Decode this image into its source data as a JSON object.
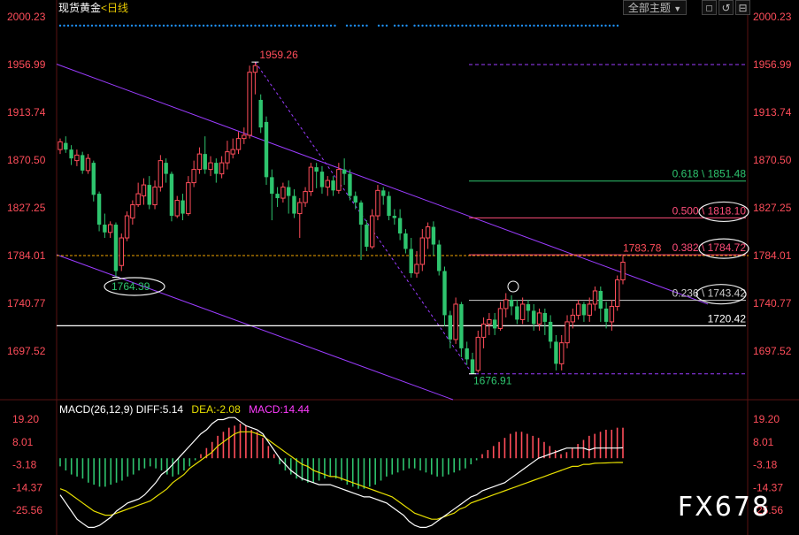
{
  "header": {
    "title": "现货黄金",
    "period": "<日线",
    "theme_label": "全部主题",
    "arrow_down": "▼",
    "toolbar_icons": [
      "◻",
      "↺",
      "⊟"
    ]
  },
  "colors": {
    "up": "#ff4d5a",
    "down": "#2ec46e",
    "price_axis": "#ff4d5a",
    "channel": "#9b3cff",
    "fib_green": "#2ec46e",
    "fib_red": "#ff4d7a",
    "fib_grey": "#cccccc",
    "support": "#ffffff",
    "current": "#f0a500",
    "macd_up": "#ff4d5a",
    "macd_down": "#2ec46e",
    "diff_line": "#ffffff",
    "dea_line": "#e8e000",
    "dot_row": "#1e90ff"
  },
  "chart_data": [
    {
      "type": "candlestick",
      "title": "现货黄金 <日线",
      "ylim": [
        1654,
        2000.23
      ],
      "y_ticks": [
        "2000.23",
        "1956.99",
        "1913.74",
        "1870.50",
        "1827.25",
        "1784.01",
        "1740.77",
        "1697.52"
      ],
      "current_price": 1784.01,
      "annotations": {
        "high": "1959.26",
        "low_left": "1764.39",
        "low_bottom": "1676.91",
        "last_high": "1783.78",
        "support_label": "1720.42"
      },
      "fib_levels": [
        {
          "ratio": "0.618",
          "value": "1851.48",
          "display": "0.618 \\ 1851.48",
          "color": "#2ec46e"
        },
        {
          "ratio": "0.500",
          "value": "1818.10",
          "display": "0.500 \\ 1818.10",
          "color": "#ff4d7a"
        },
        {
          "ratio": "0.382",
          "value": "1784.72",
          "display": "0.382 \\ 1784.72",
          "color": "#ff4d7a"
        },
        {
          "ratio": "0.236",
          "value": "1743.42",
          "display": "0.236 \\ 1743.42",
          "color": "#cccccc"
        }
      ],
      "candles": [
        [
          1880,
          1887,
          1876,
          1890
        ],
        [
          1886,
          1880,
          1877,
          1892
        ],
        [
          1880,
          1872,
          1866,
          1884
        ],
        [
          1870,
          1875,
          1865,
          1880
        ],
        [
          1875,
          1861,
          1858,
          1878
        ],
        [
          1861,
          1872,
          1858,
          1876
        ],
        [
          1868,
          1839,
          1833,
          1870
        ],
        [
          1840,
          1812,
          1806,
          1842
        ],
        [
          1812,
          1805,
          1800,
          1822
        ],
        [
          1805,
          1812,
          1800,
          1815
        ],
        [
          1812,
          1770,
          1764.4,
          1814
        ],
        [
          1775,
          1800,
          1770,
          1804
        ],
        [
          1800,
          1820,
          1797,
          1824
        ],
        [
          1818,
          1830,
          1812,
          1834
        ],
        [
          1830,
          1840,
          1828,
          1850
        ],
        [
          1838,
          1848,
          1830,
          1854
        ],
        [
          1848,
          1830,
          1826,
          1856
        ],
        [
          1830,
          1846,
          1826,
          1852
        ],
        [
          1846,
          1870,
          1842,
          1875
        ],
        [
          1868,
          1858,
          1850,
          1872
        ],
        [
          1858,
          1820,
          1815,
          1860
        ],
        [
          1820,
          1834,
          1818,
          1838
        ],
        [
          1834,
          1822,
          1816,
          1840
        ],
        [
          1822,
          1850,
          1820,
          1856
        ],
        [
          1850,
          1862,
          1846,
          1870
        ],
        [
          1862,
          1876,
          1858,
          1882
        ],
        [
          1876,
          1862,
          1858,
          1892
        ],
        [
          1862,
          1868,
          1856,
          1874
        ],
        [
          1868,
          1858,
          1850,
          1872
        ],
        [
          1858,
          1868,
          1854,
          1874
        ],
        [
          1868,
          1878,
          1862,
          1888
        ],
        [
          1876,
          1880,
          1872,
          1890
        ],
        [
          1880,
          1890,
          1876,
          1896
        ],
        [
          1890,
          1893,
          1885,
          1900
        ],
        [
          1893,
          1950,
          1890,
          1956
        ],
        [
          1950,
          1956,
          1930,
          1959.26
        ],
        [
          1925,
          1900,
          1895,
          1930
        ],
        [
          1905,
          1855,
          1848,
          1910
        ],
        [
          1855,
          1840,
          1816,
          1862
        ],
        [
          1840,
          1836,
          1828,
          1846
        ],
        [
          1836,
          1846,
          1832,
          1850
        ],
        [
          1846,
          1838,
          1822,
          1852
        ],
        [
          1838,
          1822,
          1818,
          1844
        ],
        [
          1822,
          1832,
          1800,
          1836
        ],
        [
          1832,
          1842,
          1828,
          1846
        ],
        [
          1842,
          1864,
          1838,
          1868
        ],
        [
          1864,
          1860,
          1845,
          1868
        ],
        [
          1860,
          1846,
          1840,
          1865
        ],
        [
          1846,
          1852,
          1838,
          1856
        ],
        [
          1852,
          1843,
          1838,
          1856
        ],
        [
          1843,
          1862,
          1840,
          1868
        ],
        [
          1862,
          1858,
          1848,
          1872
        ],
        [
          1858,
          1838,
          1834,
          1862
        ],
        [
          1838,
          1832,
          1826,
          1842
        ],
        [
          1832,
          1812,
          1780,
          1834
        ],
        [
          1812,
          1792,
          1788,
          1816
        ],
        [
          1792,
          1820,
          1790,
          1826
        ],
        [
          1820,
          1843,
          1816,
          1848
        ],
        [
          1843,
          1838,
          1830,
          1846
        ],
        [
          1838,
          1820,
          1816,
          1842
        ],
        [
          1820,
          1818,
          1812,
          1826
        ],
        [
          1818,
          1804,
          1798,
          1826
        ],
        [
          1804,
          1790,
          1786,
          1808
        ],
        [
          1790,
          1768,
          1764,
          1800
        ],
        [
          1768,
          1776,
          1764,
          1788
        ],
        [
          1776,
          1800,
          1770,
          1808
        ],
        [
          1800,
          1810,
          1790,
          1814
        ],
        [
          1810,
          1794,
          1784,
          1815
        ],
        [
          1794,
          1770,
          1766,
          1798
        ],
        [
          1770,
          1730,
          1720,
          1774
        ],
        [
          1730,
          1708,
          1700,
          1734
        ],
        [
          1708,
          1740,
          1704,
          1746
        ],
        [
          1740,
          1700,
          1692,
          1742
        ],
        [
          1700,
          1690,
          1685,
          1706
        ],
        [
          1690,
          1676.91,
          1676.91,
          1696
        ],
        [
          1680,
          1710,
          1678,
          1716
        ],
        [
          1710,
          1722,
          1700,
          1728
        ],
        [
          1722,
          1726,
          1712,
          1732
        ],
        [
          1726,
          1718,
          1712,
          1732
        ],
        [
          1718,
          1736,
          1716,
          1742
        ],
        [
          1736,
          1744,
          1728,
          1750
        ],
        [
          1744,
          1738,
          1730,
          1748
        ],
        [
          1738,
          1726,
          1722,
          1744
        ],
        [
          1726,
          1740,
          1722,
          1746
        ],
        [
          1740,
          1734,
          1724,
          1744
        ],
        [
          1734,
          1722,
          1716,
          1740
        ],
        [
          1722,
          1732,
          1716,
          1736
        ],
        [
          1732,
          1724,
          1712,
          1736
        ],
        [
          1724,
          1706,
          1700,
          1730
        ],
        [
          1706,
          1686,
          1680,
          1712
        ],
        [
          1686,
          1705,
          1680,
          1712
        ],
        [
          1705,
          1724,
          1700,
          1730
        ],
        [
          1724,
          1730,
          1718,
          1736
        ],
        [
          1730,
          1740,
          1726,
          1744
        ],
        [
          1740,
          1730,
          1724,
          1742
        ],
        [
          1730,
          1740,
          1724,
          1746
        ],
        [
          1740,
          1752,
          1734,
          1756
        ],
        [
          1752,
          1736,
          1724,
          1756
        ],
        [
          1736,
          1724,
          1718,
          1742
        ],
        [
          1724,
          1738,
          1716,
          1744
        ],
        [
          1738,
          1762,
          1734,
          1766
        ],
        [
          1762,
          1778,
          1758,
          1783.78
        ]
      ]
    },
    {
      "type": "macd",
      "label": "MACD(26,12,9)",
      "diff_label": "DIFF:5.14",
      "dea_label": "DEA:-2.08",
      "macd_label": "MACD:14.44",
      "ylim": [
        -36,
        26
      ],
      "y_ticks": [
        "19.20",
        "8.01",
        "-3.18",
        "-14.37",
        "-25.56"
      ],
      "hist": [
        -4,
        -6,
        -8,
        -9,
        -10,
        -12,
        -13,
        -14,
        -14,
        -13,
        -12,
        -11,
        -9,
        -8,
        -6,
        -5,
        -4,
        -5,
        -6,
        -8,
        -9,
        -8,
        -6,
        -4,
        -1,
        2,
        5,
        8,
        11,
        13,
        15,
        16,
        17,
        16,
        14,
        13,
        10,
        6,
        2,
        -3,
        -6,
        -8,
        -10,
        -11,
        -12,
        -12,
        -11,
        -10,
        -9,
        -10,
        -11,
        -13,
        -14,
        -15,
        -15,
        -14,
        -13,
        -11,
        -9,
        -8,
        -7,
        -6,
        -5,
        -5,
        -6,
        -7,
        -8,
        -9,
        -9,
        -8,
        -7,
        -6,
        -5,
        -3,
        -1,
        2,
        4,
        6,
        8,
        10,
        12,
        13,
        13,
        12,
        11,
        10,
        8,
        6,
        4,
        2,
        3,
        5,
        7,
        9,
        11,
        12,
        13,
        14,
        14,
        15,
        15
      ],
      "diff": [
        -18,
        -22,
        -26,
        -30,
        -32,
        -34,
        -34,
        -33,
        -31,
        -29,
        -26,
        -24,
        -22,
        -21,
        -20,
        -18,
        -15,
        -12,
        -8,
        -6,
        -3,
        0,
        3,
        6,
        9,
        12,
        14,
        17,
        19,
        19,
        20,
        20,
        18,
        16,
        15,
        14,
        12,
        8,
        4,
        0,
        -3,
        -6,
        -8,
        -10,
        -11,
        -12,
        -13,
        -13,
        -13,
        -14,
        -15,
        -16,
        -17,
        -18,
        -19,
        -19,
        -20,
        -21,
        -22,
        -24,
        -26,
        -28,
        -31,
        -33,
        -34,
        -34,
        -33,
        -31,
        -29,
        -27,
        -25,
        -23,
        -21,
        -19,
        -18,
        -16,
        -15,
        -14,
        -13,
        -12,
        -10,
        -8,
        -6,
        -4,
        -2,
        0,
        1,
        2,
        3,
        4,
        5,
        5,
        5,
        5,
        4,
        5,
        5,
        5,
        5,
        5,
        5.14
      ],
      "dea": [
        -15,
        -16,
        -18,
        -20,
        -22,
        -24,
        -26,
        -27,
        -28,
        -28,
        -27,
        -26,
        -25,
        -24,
        -23,
        -22,
        -21,
        -19,
        -17,
        -15,
        -12,
        -10,
        -8,
        -5,
        -3,
        -1,
        1,
        3,
        6,
        8,
        10,
        12,
        13,
        13,
        13,
        12,
        11,
        9,
        7,
        5,
        3,
        1,
        -1,
        -3,
        -4,
        -6,
        -7,
        -8,
        -9,
        -9,
        -10,
        -11,
        -12,
        -13,
        -14,
        -15,
        -16,
        -17,
        -18,
        -19,
        -21,
        -23,
        -25,
        -27,
        -28,
        -29,
        -30,
        -30,
        -29,
        -28,
        -27,
        -25,
        -24,
        -22,
        -21,
        -20,
        -19,
        -18,
        -17,
        -16,
        -15,
        -14,
        -13,
        -12,
        -11,
        -10,
        -9,
        -8,
        -7,
        -6,
        -5,
        -4,
        -4,
        -3,
        -3,
        -2.5,
        -2.4,
        -2.3,
        -2.2,
        -2.1,
        -2.08
      ]
    }
  ],
  "watermark": "FX678"
}
